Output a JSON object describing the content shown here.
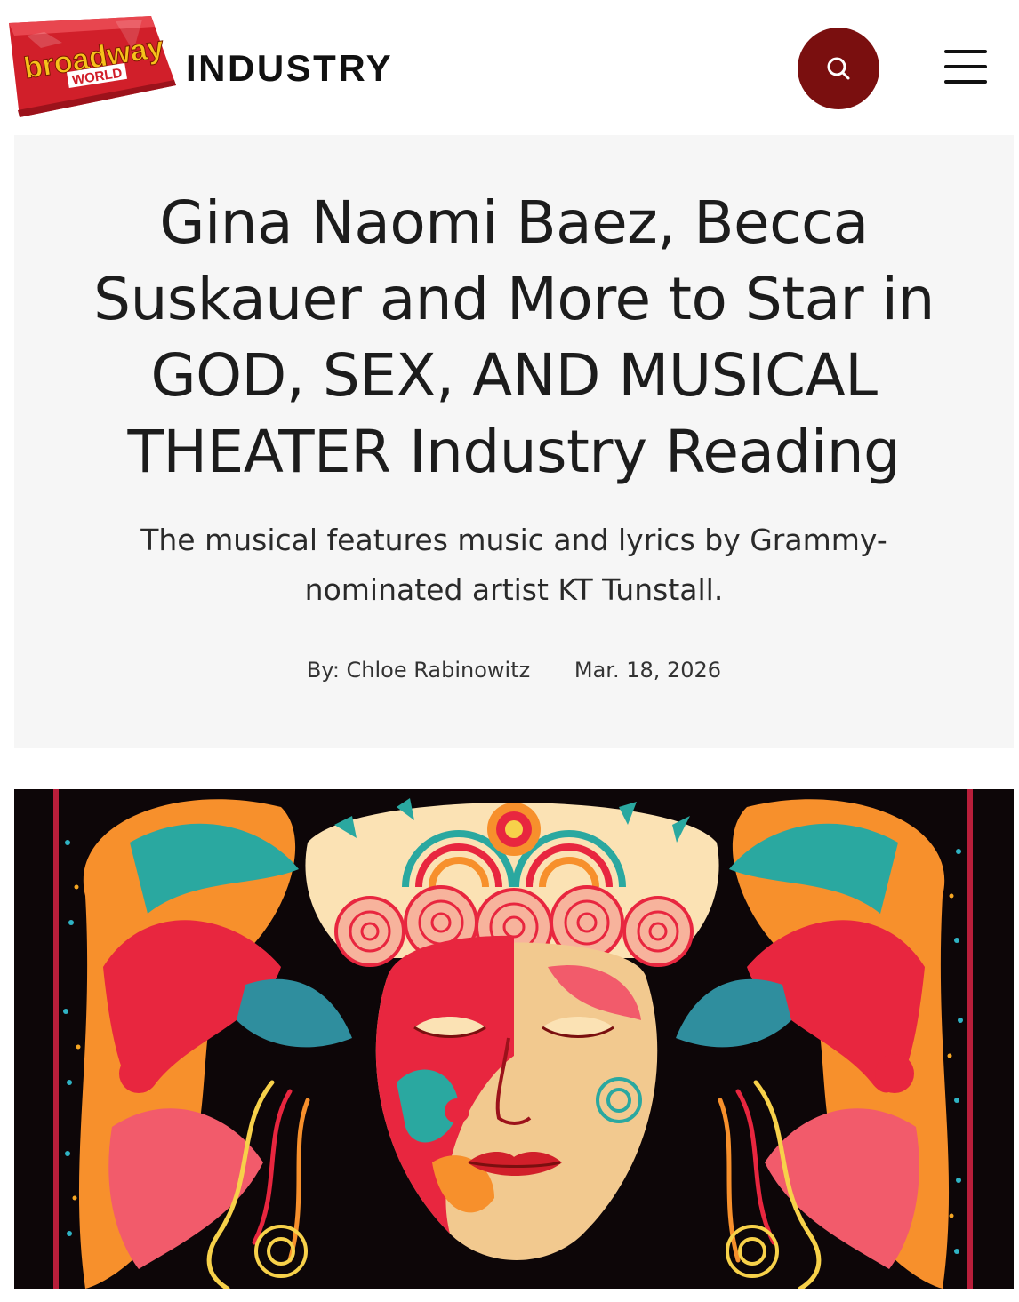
{
  "header": {
    "logo_text_top": "broadway",
    "logo_text_bottom": "WORLD",
    "section": "INDUSTRY",
    "search_icon": "search-icon",
    "menu_icon": "hamburger-menu-icon",
    "search_button_color": "#7a0f0f",
    "logo_color": "#d11f2a"
  },
  "article": {
    "headline": "Gina Naomi Baez, Becca Suskauer and More to Star in GOD, SEX, AND MUSICAL THEATER Industry Reading",
    "subhead": "The musical features music and lyrics by Grammy-nominated artist KT Tunstall.",
    "byline_prefix": "By: ",
    "author": "Chloe Rabinowitz",
    "date": "Mar. 18, 2026"
  },
  "hero_image": {
    "subject": "psychedelic-illustrated-face-artwork"
  }
}
